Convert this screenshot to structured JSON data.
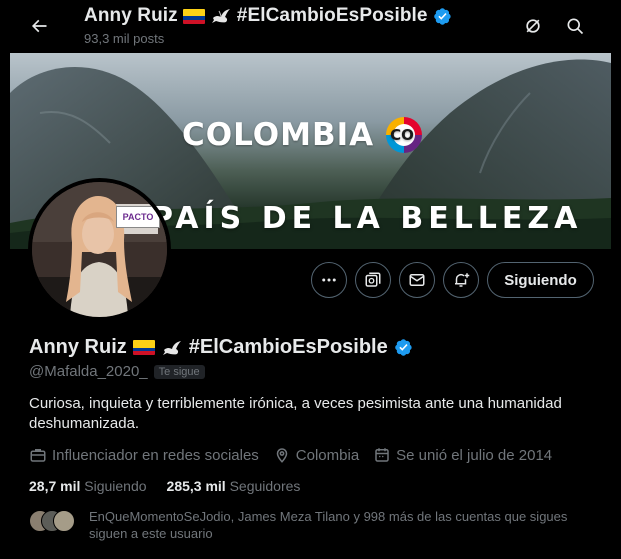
{
  "header": {
    "name": "Anny Ruiz",
    "hashtag": "#ElCambioEsPosible",
    "posts_count": "93,3 mil posts",
    "back_icon": "arrow-left-icon",
    "grok_icon": "grok-icon",
    "search_icon": "search-icon"
  },
  "banner": {
    "title": "COLOMBIA",
    "logo_text": "CO",
    "subtitle": "EL PAÍS DE LA BELLEZA",
    "inset_logo_text": "PACTO"
  },
  "actions": {
    "more_icon": "more-icon",
    "grok_icon": "grok-profile-icon",
    "message_icon": "envelope-icon",
    "notify_icon": "bell-plus-icon",
    "follow_label": "Siguiendo"
  },
  "profile": {
    "name": "Anny Ruiz",
    "hashtag": "#ElCambioEsPosible",
    "handle": "@Mafalda_2020_",
    "follows_you": "Te sigue",
    "bio": "Curiosa, inquieta y terriblemente irónica, a veces pesimista ante una humanidad deshumanizada.",
    "category": "Influenciador en redes sociales",
    "location": "Colombia",
    "joined": "Se unió el julio de 2014",
    "following_count": "28,7 mil",
    "following_label": "Siguiendo",
    "followers_count": "285,3 mil",
    "followers_label": "Seguidores",
    "known_followers_text": "EnQueMomentoSeJodio, James Meza Tilano y 998 más de las cuentas que sigues siguen a este usuario"
  },
  "colors": {
    "background": "#000000",
    "text_primary": "#e7e9ea",
    "text_secondary": "#71767b",
    "border": "#536471",
    "verified": "#1d9bf0"
  }
}
